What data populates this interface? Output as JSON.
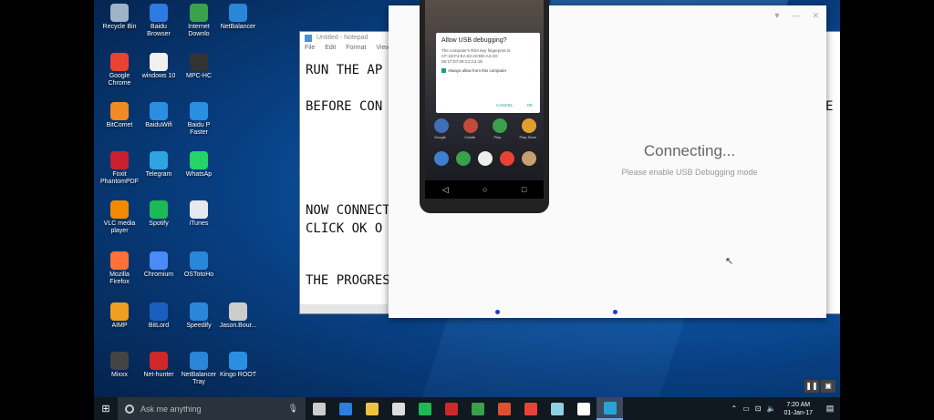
{
  "desktop_icons": [
    {
      "label": "Recycle Bin",
      "color": "#9fb4c8"
    },
    {
      "label": "Baidu Browser",
      "color": "#2d7be0"
    },
    {
      "label": "Internet Downlo",
      "color": "#3aa14a"
    },
    {
      "label": "NetBalancer",
      "color": "#2a86d8"
    },
    {
      "label": "Google Chrome",
      "color": "#e94235"
    },
    {
      "label": "windows 10",
      "color": "#f0f0f0"
    },
    {
      "label": "MPC-HC",
      "color": "#333333"
    },
    {
      "label": "BitComet",
      "color": "#f08a24"
    },
    {
      "label": "BaiduWifi",
      "color": "#2a8fe0"
    },
    {
      "label": "Baidu P Faster",
      "color": "#2a8fe0"
    },
    {
      "label": "Foxit PhantomPDF",
      "color": "#c8202f"
    },
    {
      "label": "Telegram",
      "color": "#2ca5e0"
    },
    {
      "label": "WhatsAp",
      "color": "#25d366"
    },
    {
      "label": "VLC media player",
      "color": "#f08a00"
    },
    {
      "label": "Spotify",
      "color": "#1db954"
    },
    {
      "label": "iTunes",
      "color": "#e8e8f0"
    },
    {
      "label": "Mozilla Firefox",
      "color": "#ff7139"
    },
    {
      "label": "Chromium",
      "color": "#4a8bf5"
    },
    {
      "label": "OSTotoHo",
      "color": "#2a86d8"
    },
    {
      "label": "AIMP",
      "color": "#f0a020"
    },
    {
      "label": "BitLord",
      "color": "#1a5fc0"
    },
    {
      "label": "Speedify",
      "color": "#2a86d8"
    },
    {
      "label": "Jason.Bour...",
      "color": "#cccccc"
    },
    {
      "label": "Mixxx",
      "color": "#444444"
    },
    {
      "label": "Net-hunter",
      "color": "#d02828"
    },
    {
      "label": "NetBalancer Tray",
      "color": "#2a86d8"
    },
    {
      "label": "Kingo ROOT",
      "color": "#2a8fe0"
    }
  ],
  "notepad": {
    "title": "Untitled - Notepad",
    "menu": [
      "File",
      "Edit",
      "Format",
      "View"
    ],
    "lines": [
      "RUN THE AP",
      "BEFORE CON",
      "NOW CONNECT",
      "CLICK OK O",
      "THE PROGRES"
    ],
    "trailing_char": "E"
  },
  "vysor": {
    "connecting_title": "Connecting...",
    "connecting_sub": "Please enable USB Debugging mode",
    "win_controls": [
      "▼",
      "—",
      "✕"
    ]
  },
  "phone_dialog": {
    "title": "Allow USB debugging?",
    "text": "The computer's RSA key fingerprint is:",
    "fingerprint": "CF:1D:F4:EA:62:A0:DE:A3:AD: 08:17:D7:09:C2:C4:1E",
    "checkbox": "Always allow from this computer",
    "cancel": "CANCEL",
    "ok": "OK"
  },
  "phone_apps_labels": [
    "Google",
    "Create",
    "Play",
    "Play Store"
  ],
  "taskbar": {
    "search_placeholder": "Ask me anything",
    "time": "7:20 AM",
    "date": "01-Jan-17",
    "apps": [
      {
        "name": "task-view",
        "color": "#cccccc"
      },
      {
        "name": "edge",
        "color": "#2a7fe0"
      },
      {
        "name": "file-explorer",
        "color": "#f0c040"
      },
      {
        "name": "store",
        "color": "#dddddd"
      },
      {
        "name": "spotify",
        "color": "#1db954"
      },
      {
        "name": "huawei",
        "color": "#d02828"
      },
      {
        "name": "android",
        "color": "#3aa14a"
      },
      {
        "name": "app-red",
        "color": "#e05030"
      },
      {
        "name": "chrome",
        "color": "#e94235"
      },
      {
        "name": "notepad",
        "color": "#8fd0e0"
      },
      {
        "name": "baidu",
        "color": "#ffffff"
      },
      {
        "name": "vysor",
        "color": "#26a4d8"
      }
    ]
  }
}
